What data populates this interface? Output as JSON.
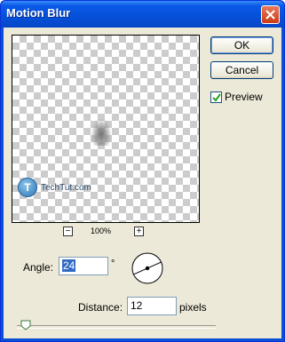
{
  "window": {
    "title": "Motion Blur"
  },
  "buttons": {
    "ok": "OK",
    "cancel": "Cancel"
  },
  "preview_option": {
    "label": "Preview",
    "checked": true
  },
  "watermark": {
    "logo_letter": "T",
    "text": "TechTut.com"
  },
  "zoom": {
    "level": "100%",
    "out_symbol": "−",
    "in_symbol": "+"
  },
  "angle": {
    "label": "Angle:",
    "value": "24",
    "unit": "°"
  },
  "distance": {
    "label": "Distance:",
    "value": "12",
    "unit": "pixels"
  },
  "colors": {
    "titlebar": "#0a5ae8",
    "dialog_bg": "#ece9d8",
    "selection": "#316ac5"
  },
  "icons": {
    "close": "close-icon",
    "check": "check-icon",
    "dial": "angle-dial-icon",
    "slider": "slider-thumb-icon"
  }
}
